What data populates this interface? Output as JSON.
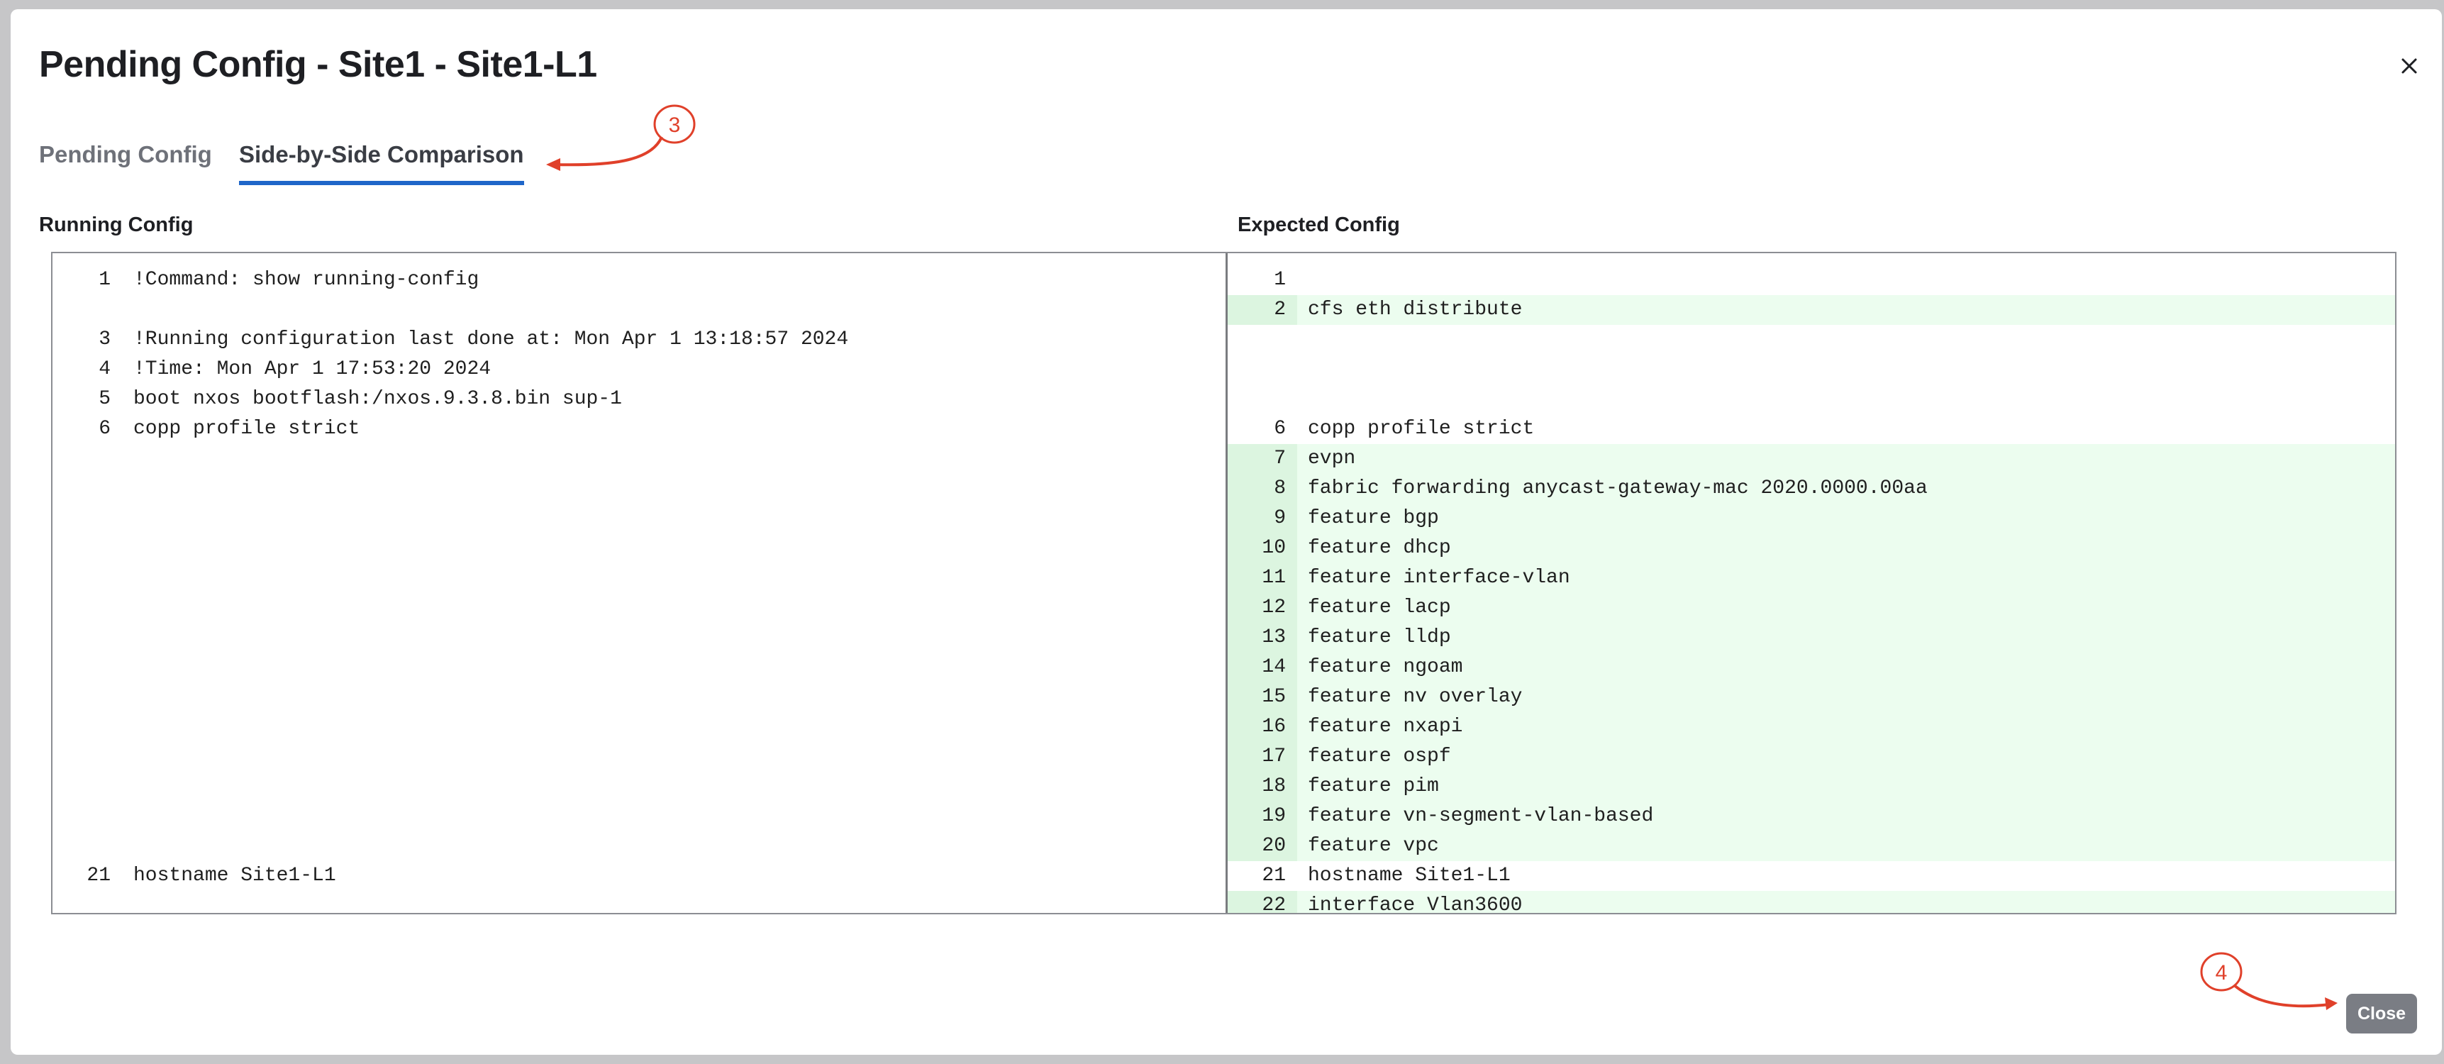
{
  "modal": {
    "title": "Pending Config - Site1 - Site1-L1",
    "tabs": [
      {
        "label": "Pending Config",
        "active": false
      },
      {
        "label": "Side-by-Side Comparison",
        "active": true
      }
    ],
    "close_button_label": "Close"
  },
  "comparison": {
    "left_header": "Running Config",
    "right_header": "Expected Config",
    "left_rows": [
      {
        "num": "1",
        "text": "!Command: show running-config",
        "type": "normal"
      },
      {
        "num": "",
        "text": "",
        "type": "blank"
      },
      {
        "num": "3",
        "text": "!Running configuration last done at: Mon Apr 1 13:18:57 2024",
        "type": "normal"
      },
      {
        "num": "4",
        "text": "!Time: Mon Apr 1 17:53:20 2024",
        "type": "normal"
      },
      {
        "num": "5",
        "text": "boot nxos bootflash:/nxos.9.3.8.bin sup-1",
        "type": "normal"
      },
      {
        "num": "6",
        "text": "copp profile strict",
        "type": "normal"
      },
      {
        "num": "",
        "text": "",
        "type": "blank"
      },
      {
        "num": "",
        "text": "",
        "type": "blank"
      },
      {
        "num": "",
        "text": "",
        "type": "blank"
      },
      {
        "num": "",
        "text": "",
        "type": "blank"
      },
      {
        "num": "",
        "text": "",
        "type": "blank"
      },
      {
        "num": "",
        "text": "",
        "type": "blank"
      },
      {
        "num": "",
        "text": "",
        "type": "blank"
      },
      {
        "num": "",
        "text": "",
        "type": "blank"
      },
      {
        "num": "",
        "text": "",
        "type": "blank"
      },
      {
        "num": "",
        "text": "",
        "type": "blank"
      },
      {
        "num": "",
        "text": "",
        "type": "blank"
      },
      {
        "num": "",
        "text": "",
        "type": "blank"
      },
      {
        "num": "",
        "text": "",
        "type": "blank"
      },
      {
        "num": "",
        "text": "",
        "type": "blank"
      },
      {
        "num": "21",
        "text": "hostname Site1-L1",
        "type": "normal"
      },
      {
        "num": "",
        "text": "",
        "type": "blank"
      }
    ],
    "right_rows": [
      {
        "num": "1",
        "text": "",
        "type": "normal"
      },
      {
        "num": "2",
        "text": "cfs eth distribute",
        "type": "added"
      },
      {
        "num": "",
        "text": "",
        "type": "blank"
      },
      {
        "num": "",
        "text": "",
        "type": "blank"
      },
      {
        "num": "",
        "text": "",
        "type": "blank"
      },
      {
        "num": "6",
        "text": "copp profile strict",
        "type": "normal"
      },
      {
        "num": "7",
        "text": "evpn",
        "type": "added"
      },
      {
        "num": "8",
        "text": "fabric forwarding anycast-gateway-mac 2020.0000.00aa",
        "type": "added"
      },
      {
        "num": "9",
        "text": "feature bgp",
        "type": "added"
      },
      {
        "num": "10",
        "text": "feature dhcp",
        "type": "added"
      },
      {
        "num": "11",
        "text": "feature interface-vlan",
        "type": "added"
      },
      {
        "num": "12",
        "text": "feature lacp",
        "type": "added"
      },
      {
        "num": "13",
        "text": "feature lldp",
        "type": "added"
      },
      {
        "num": "14",
        "text": "feature ngoam",
        "type": "added"
      },
      {
        "num": "15",
        "text": "feature nv overlay",
        "type": "added"
      },
      {
        "num": "16",
        "text": "feature nxapi",
        "type": "added"
      },
      {
        "num": "17",
        "text": "feature ospf",
        "type": "added"
      },
      {
        "num": "18",
        "text": "feature pim",
        "type": "added"
      },
      {
        "num": "19",
        "text": "feature vn-segment-vlan-based",
        "type": "added"
      },
      {
        "num": "20",
        "text": "feature vpc",
        "type": "added"
      },
      {
        "num": "21",
        "text": "hostname Site1-L1",
        "type": "normal"
      },
      {
        "num": "22",
        "text": "interface Vlan3600",
        "type": "added"
      }
    ]
  },
  "annotations": [
    {
      "label": "3",
      "color": "#e0402a"
    },
    {
      "label": "4",
      "color": "#e0402a"
    }
  ],
  "colors": {
    "accent_tab_underline": "#1f66c9",
    "added_row_bg": "#ecfdef",
    "added_gutter_bg": "#dcf5e0",
    "annotation": "#e0402a",
    "close_button_bg": "#7a7d84"
  },
  "icons": {
    "close": "close-icon"
  }
}
